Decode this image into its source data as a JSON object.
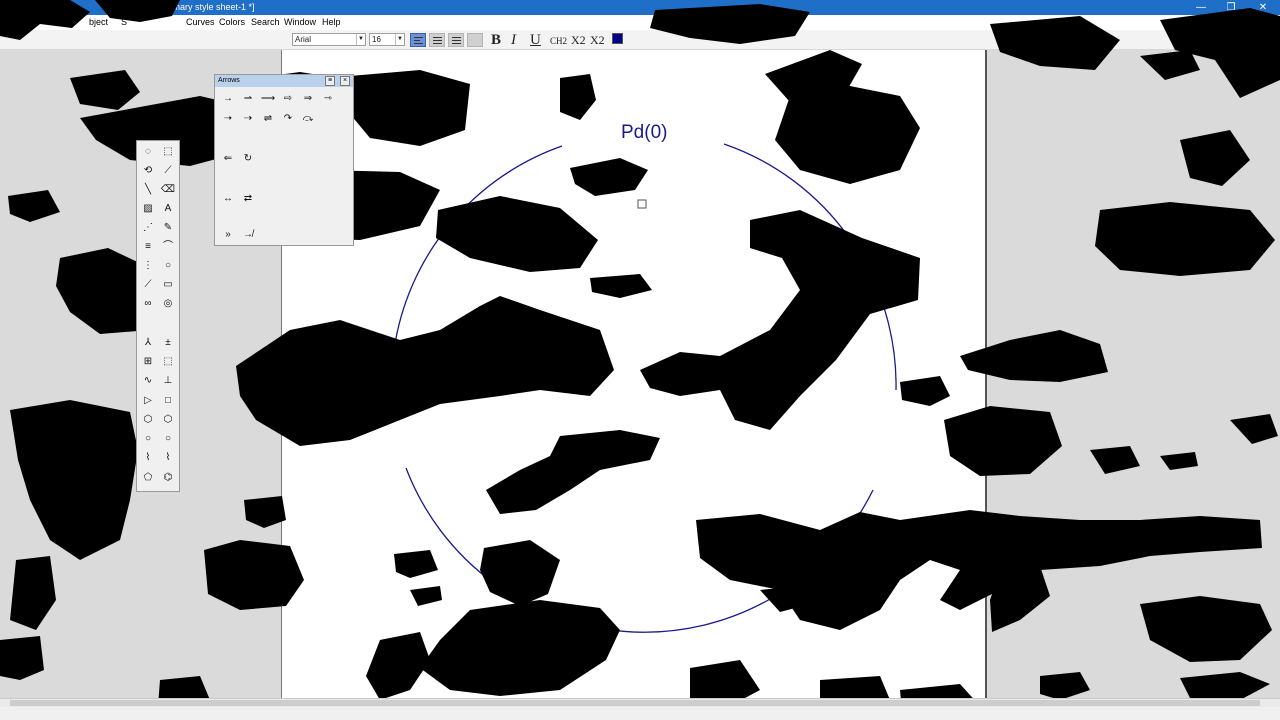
{
  "window": {
    "title": "ummary style sheet-1 *]",
    "app_icon": "C",
    "minimize": "—",
    "maximize": "❐",
    "close": "✕"
  },
  "menu": {
    "items": [
      "bject",
      "S",
      "Curves",
      "Colors",
      "Search",
      "Window",
      "Help"
    ]
  },
  "format": {
    "font": "Arial",
    "size": "16",
    "bold": "B",
    "italic": "I",
    "underline": "U",
    "chem": "CH2",
    "subscript": "X2",
    "superscript": "X2",
    "text_color": "#00008b"
  },
  "arrows_palette": {
    "title": "Arrows",
    "close": "×",
    "menu": "≡"
  },
  "canvas": {
    "label": "Pd(0)",
    "arc_color": "#1a1a8c"
  },
  "tools": {
    "icons": [
      "lasso-icon",
      "marquee-icon",
      "rotate-icon",
      "bond-icon",
      "line-icon",
      "eraser-icon",
      "hatch-icon",
      "text-icon",
      "dashed-bond-icon",
      "pen-icon",
      "multi-bond-icon",
      "arc-icon",
      "wedge-icon",
      "circle-icon",
      "chain-icon",
      "rectangle-icon",
      "orbital-icon",
      "template-icon",
      "sub-icon",
      "atom-map-icon",
      "table-icon",
      "frame-icon",
      "curve-icon",
      "stamp-icon",
      "play-icon",
      "square-icon",
      "cyclohexane-icon",
      "hexagon-icon",
      "ring-icon",
      "circle-shape-icon",
      "chair-icon",
      "boat-icon",
      "cyclopentane-icon",
      "benzene-icon"
    ]
  }
}
